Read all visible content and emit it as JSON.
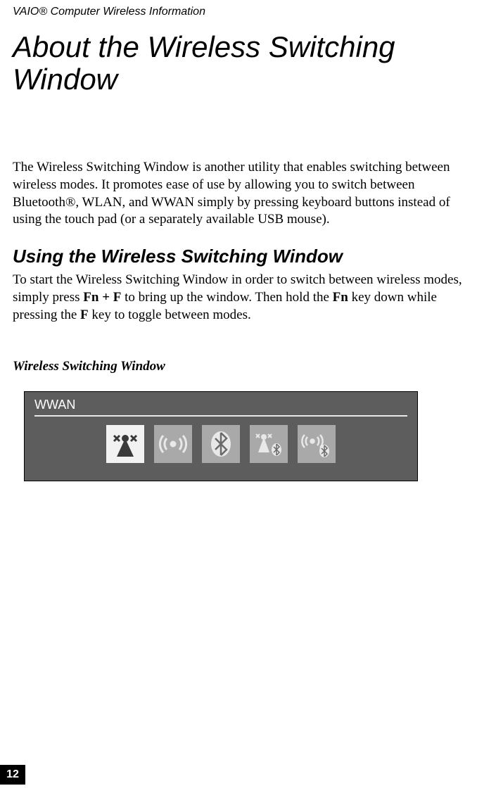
{
  "header": {
    "text": "VAIO® Computer Wireless Information"
  },
  "title": "About the Wireless Switching Window",
  "intro": "The Wireless Switching Window is another utility that enables switching between wireless modes. It promotes ease of use by allowing you to switch between Bluetooth®, WLAN, and WWAN simply by pressing keyboard buttons instead of using the touch pad (or a separately available USB mouse).",
  "section": {
    "heading": "Using the Wireless Switching Window",
    "body_pre": "To start the Wireless Switching Window in order to switch between wireless modes, simply press ",
    "key1": "Fn + F",
    "body_mid": " to bring up the window. Then hold the ",
    "key2": "Fn",
    "body_mid2": " key down while pressing the ",
    "key3": "F",
    "body_post": " key to toggle between modes."
  },
  "figure": {
    "caption": "Wireless Switching Window",
    "label": "WWAN",
    "icons": [
      {
        "name": "wwan-icon",
        "highlight": true
      },
      {
        "name": "wlan-icon",
        "highlight": false
      },
      {
        "name": "bluetooth-icon",
        "highlight": false
      },
      {
        "name": "wwan-bluetooth-icon",
        "highlight": false
      },
      {
        "name": "wlan-bluetooth-icon",
        "highlight": false
      }
    ]
  },
  "page_number": "12"
}
